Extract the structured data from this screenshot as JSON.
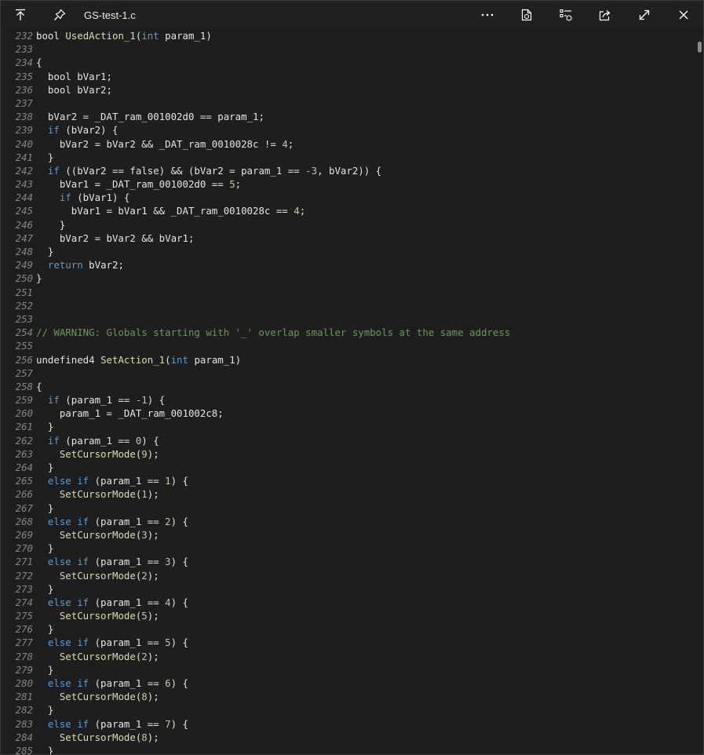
{
  "window": {
    "filename": "GS-test-1.c",
    "icons": [
      "go-to-top-icon",
      "pin-icon",
      "more-icon",
      "open-file-icon",
      "compare-icon",
      "share-icon",
      "expand-icon",
      "close-icon"
    ]
  },
  "code": [
    {
      "n": "232",
      "t": [
        [
          "",
          "bool "
        ],
        [
          "fn",
          "UsedAction_1"
        ],
        [
          "",
          "("
        ],
        [
          "kw",
          "int"
        ],
        [
          "",
          " param_1)"
        ]
      ]
    },
    {
      "n": "233",
      "t": []
    },
    {
      "n": "234",
      "t": [
        [
          "",
          "{"
        ]
      ]
    },
    {
      "n": "235",
      "t": [
        [
          "",
          "  bool bVar1;"
        ]
      ]
    },
    {
      "n": "236",
      "t": [
        [
          "",
          "  bool bVar2;"
        ]
      ]
    },
    {
      "n": "237",
      "t": []
    },
    {
      "n": "238",
      "t": [
        [
          "",
          "  bVar2 = _DAT_ram_001002d0 == param_1;"
        ]
      ]
    },
    {
      "n": "239",
      "t": [
        [
          "",
          "  "
        ],
        [
          "kw",
          "if"
        ],
        [
          "",
          " (bVar2) {"
        ]
      ]
    },
    {
      "n": "240",
      "t": [
        [
          "",
          "    bVar2 = bVar2 && _DAT_ram_0010028c != "
        ],
        [
          "num",
          "4"
        ],
        [
          "",
          ";"
        ]
      ]
    },
    {
      "n": "241",
      "t": [
        [
          "",
          "  }"
        ]
      ]
    },
    {
      "n": "242",
      "t": [
        [
          "",
          "  "
        ],
        [
          "kw",
          "if"
        ],
        [
          "",
          " ((bVar2 == false) && (bVar2 = param_1 == "
        ],
        [
          "num",
          "-3"
        ],
        [
          "",
          ", bVar2)) {"
        ]
      ]
    },
    {
      "n": "243",
      "t": [
        [
          "",
          "    bVar1 = _DAT_ram_001002d0 == "
        ],
        [
          "num",
          "5"
        ],
        [
          "",
          ";"
        ]
      ]
    },
    {
      "n": "244",
      "t": [
        [
          "",
          "    "
        ],
        [
          "kw",
          "if"
        ],
        [
          "",
          " (bVar1) {"
        ]
      ]
    },
    {
      "n": "245",
      "t": [
        [
          "",
          "      bVar1 = bVar1 && _DAT_ram_0010028c == "
        ],
        [
          "num",
          "4"
        ],
        [
          "",
          ";"
        ]
      ]
    },
    {
      "n": "246",
      "t": [
        [
          "",
          "    }"
        ]
      ]
    },
    {
      "n": "247",
      "t": [
        [
          "",
          "    bVar2 = bVar2 && bVar1;"
        ]
      ]
    },
    {
      "n": "248",
      "t": [
        [
          "",
          "  }"
        ]
      ]
    },
    {
      "n": "249",
      "t": [
        [
          "",
          "  "
        ],
        [
          "kw",
          "return"
        ],
        [
          "",
          " bVar2;"
        ]
      ]
    },
    {
      "n": "250",
      "t": [
        [
          "",
          "}"
        ]
      ]
    },
    {
      "n": "251",
      "t": []
    },
    {
      "n": "252",
      "t": []
    },
    {
      "n": "253",
      "t": []
    },
    {
      "n": "254",
      "t": [
        [
          "cm",
          "// WARNING: Globals starting with '_' overlap smaller symbols at the same address"
        ]
      ]
    },
    {
      "n": "255",
      "t": []
    },
    {
      "n": "256",
      "t": [
        [
          "",
          "undefined4 "
        ],
        [
          "fn",
          "SetAction_1"
        ],
        [
          "",
          "("
        ],
        [
          "kw",
          "int"
        ],
        [
          "",
          " param_1)"
        ]
      ]
    },
    {
      "n": "257",
      "t": []
    },
    {
      "n": "258",
      "t": [
        [
          "",
          "{"
        ]
      ]
    },
    {
      "n": "259",
      "t": [
        [
          "",
          "  "
        ],
        [
          "kw",
          "if"
        ],
        [
          "",
          " (param_1 == "
        ],
        [
          "num",
          "-1"
        ],
        [
          "",
          ") {"
        ]
      ]
    },
    {
      "n": "260",
      "t": [
        [
          "",
          "    param_1 = _DAT_ram_001002c8;"
        ]
      ]
    },
    {
      "n": "261",
      "t": [
        [
          "",
          "  }"
        ]
      ]
    },
    {
      "n": "262",
      "t": [
        [
          "",
          "  "
        ],
        [
          "kw",
          "if"
        ],
        [
          "",
          " (param_1 == "
        ],
        [
          "num",
          "0"
        ],
        [
          "",
          ") {"
        ]
      ]
    },
    {
      "n": "263",
      "t": [
        [
          "",
          "    "
        ],
        [
          "fn",
          "SetCursorMode"
        ],
        [
          "",
          "("
        ],
        [
          "num",
          "9"
        ],
        [
          "",
          ");"
        ]
      ]
    },
    {
      "n": "264",
      "t": [
        [
          "",
          "  }"
        ]
      ]
    },
    {
      "n": "265",
      "t": [
        [
          "",
          "  "
        ],
        [
          "kw",
          "else if"
        ],
        [
          "",
          " (param_1 == "
        ],
        [
          "num",
          "1"
        ],
        [
          "",
          ") {"
        ]
      ]
    },
    {
      "n": "266",
      "t": [
        [
          "",
          "    "
        ],
        [
          "fn",
          "SetCursorMode"
        ],
        [
          "",
          "("
        ],
        [
          "num",
          "1"
        ],
        [
          "",
          ");"
        ]
      ]
    },
    {
      "n": "267",
      "t": [
        [
          "",
          "  }"
        ]
      ]
    },
    {
      "n": "268",
      "t": [
        [
          "",
          "  "
        ],
        [
          "kw",
          "else if"
        ],
        [
          "",
          " (param_1 == "
        ],
        [
          "num",
          "2"
        ],
        [
          "",
          ") {"
        ]
      ]
    },
    {
      "n": "269",
      "t": [
        [
          "",
          "    "
        ],
        [
          "fn",
          "SetCursorMode"
        ],
        [
          "",
          "("
        ],
        [
          "num",
          "3"
        ],
        [
          "",
          ");"
        ]
      ]
    },
    {
      "n": "270",
      "t": [
        [
          "",
          "  }"
        ]
      ]
    },
    {
      "n": "271",
      "t": [
        [
          "",
          "  "
        ],
        [
          "kw",
          "else if"
        ],
        [
          "",
          " (param_1 == "
        ],
        [
          "num",
          "3"
        ],
        [
          "",
          ") {"
        ]
      ]
    },
    {
      "n": "272",
      "t": [
        [
          "",
          "    "
        ],
        [
          "fn",
          "SetCursorMode"
        ],
        [
          "",
          "("
        ],
        [
          "num",
          "2"
        ],
        [
          "",
          ");"
        ]
      ]
    },
    {
      "n": "273",
      "t": [
        [
          "",
          "  }"
        ]
      ]
    },
    {
      "n": "274",
      "t": [
        [
          "",
          "  "
        ],
        [
          "kw",
          "else if"
        ],
        [
          "",
          " (param_1 == "
        ],
        [
          "num",
          "4"
        ],
        [
          "",
          ") {"
        ]
      ]
    },
    {
      "n": "275",
      "t": [
        [
          "",
          "    "
        ],
        [
          "fn",
          "SetCursorMode"
        ],
        [
          "",
          "("
        ],
        [
          "num",
          "5"
        ],
        [
          "",
          ");"
        ]
      ]
    },
    {
      "n": "276",
      "t": [
        [
          "",
          "  }"
        ]
      ]
    },
    {
      "n": "277",
      "t": [
        [
          "",
          "  "
        ],
        [
          "kw",
          "else if"
        ],
        [
          "",
          " (param_1 == "
        ],
        [
          "num",
          "5"
        ],
        [
          "",
          ") {"
        ]
      ]
    },
    {
      "n": "278",
      "t": [
        [
          "",
          "    "
        ],
        [
          "fn",
          "SetCursorMode"
        ],
        [
          "",
          "("
        ],
        [
          "num",
          "2"
        ],
        [
          "",
          ");"
        ]
      ]
    },
    {
      "n": "279",
      "t": [
        [
          "",
          "  }"
        ]
      ]
    },
    {
      "n": "280",
      "t": [
        [
          "",
          "  "
        ],
        [
          "kw",
          "else if"
        ],
        [
          "",
          " (param_1 == "
        ],
        [
          "num",
          "6"
        ],
        [
          "",
          ") {"
        ]
      ]
    },
    {
      "n": "281",
      "t": [
        [
          "",
          "    "
        ],
        [
          "fn",
          "SetCursorMode"
        ],
        [
          "",
          "("
        ],
        [
          "num",
          "8"
        ],
        [
          "",
          ");"
        ]
      ]
    },
    {
      "n": "282",
      "t": [
        [
          "",
          "  }"
        ]
      ]
    },
    {
      "n": "283",
      "t": [
        [
          "",
          "  "
        ],
        [
          "kw",
          "else if"
        ],
        [
          "",
          " (param_1 == "
        ],
        [
          "num",
          "7"
        ],
        [
          "",
          ") {"
        ]
      ]
    },
    {
      "n": "284",
      "t": [
        [
          "",
          "    "
        ],
        [
          "fn",
          "SetCursorMode"
        ],
        [
          "",
          "("
        ],
        [
          "num",
          "8"
        ],
        [
          "",
          ");"
        ]
      ]
    },
    {
      "n": "285",
      "t": [
        [
          "",
          "  }"
        ]
      ]
    }
  ]
}
